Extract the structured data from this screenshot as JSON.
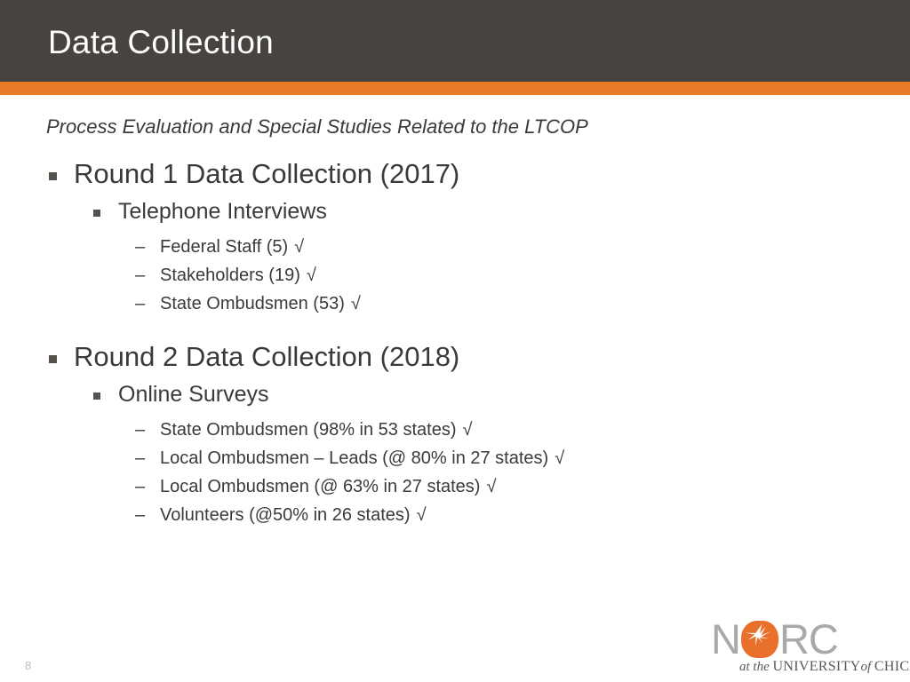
{
  "slide": {
    "title": "Data Collection",
    "subtitle": "Process Evaluation and Special Studies Related to the LTCOP",
    "page_number": "8",
    "colors": {
      "header_bar": "#474340",
      "accent_stripe": "#E87B28",
      "body_text": "#3a3a38",
      "title_text": "#ffffff",
      "logo_orange": "#E8702A",
      "logo_gray": "#a7a9ac"
    }
  },
  "sections": [
    {
      "heading": "Round 1 Data Collection (2017)",
      "bullet_glyph": "square",
      "sub_heading": "Telephone Interviews",
      "items": [
        {
          "dash": "–",
          "text": "Federal Staff (5)",
          "check": "√"
        },
        {
          "dash": "–",
          "text": "Stakeholders (19)",
          "check": "√"
        },
        {
          "dash": "–",
          "text": "State Ombudsmen (53)",
          "check": "√"
        }
      ]
    },
    {
      "heading": "Round 2 Data Collection (2018)",
      "bullet_glyph": "square",
      "sub_heading": "Online Surveys",
      "items": [
        {
          "dash": "–",
          "text": "State Ombudsmen (98% in 53 states)",
          "check": "√"
        },
        {
          "dash": "–",
          "text": "Local Ombudsmen – Leads (@ 80% in 27 states)",
          "check": "√"
        },
        {
          "dash": "–",
          "text": "Local Ombudsmen (@ 63% in 27 states)",
          "check": "√"
        },
        {
          "dash": "–",
          "text": "Volunteers (@50% in 26 states)",
          "check": "√"
        }
      ]
    }
  ],
  "logo": {
    "letter_n": "N",
    "letter_r": "R",
    "letter_c": "C",
    "tagline_at_the": "at the",
    "tagline_university": "UNIVERSITY",
    "tagline_of": "of",
    "tagline_chicago": "CHICAGO"
  }
}
